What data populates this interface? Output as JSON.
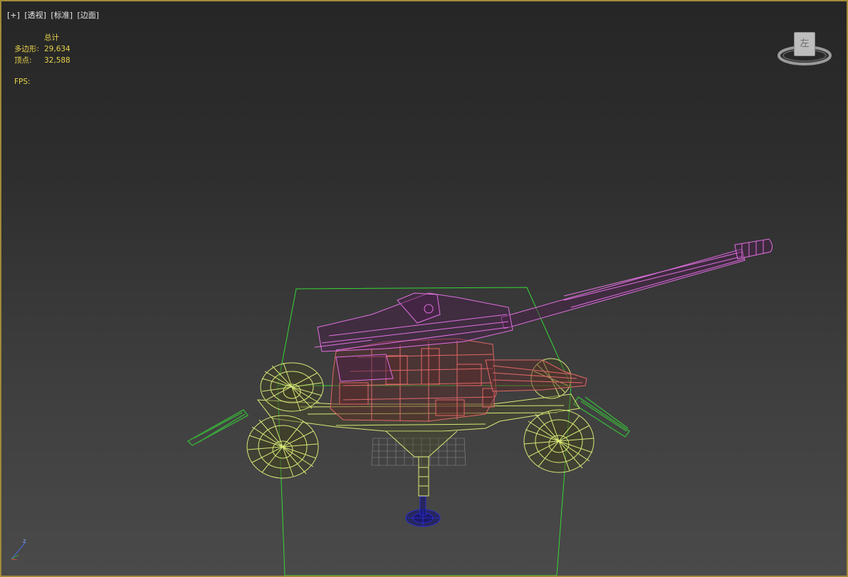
{
  "viewport": {
    "label_parts": [
      "[+]",
      "[透视]",
      "[标准]",
      "[边面]"
    ],
    "stats": {
      "header": "总计",
      "polys_label": "多边形:",
      "polys_value": "29,634",
      "verts_label": "顶点:",
      "verts_value": "32,588",
      "fps_label": "FPS:"
    },
    "viewcube": {
      "face_label": "左",
      "icon": "viewcube-icon"
    },
    "axis": {
      "z_label": "z",
      "icon": "axis-tripod-icon"
    }
  },
  "colors": {
    "viewport_border": "#a08a3a",
    "stats_text": "#e8d24a",
    "barrel": "#e070e0",
    "body": "#e06868",
    "carriage": "#d8e878",
    "outrigger": "#3aa83a",
    "bounding_box": "#36d636",
    "base_plate": "#2a2ad0"
  }
}
